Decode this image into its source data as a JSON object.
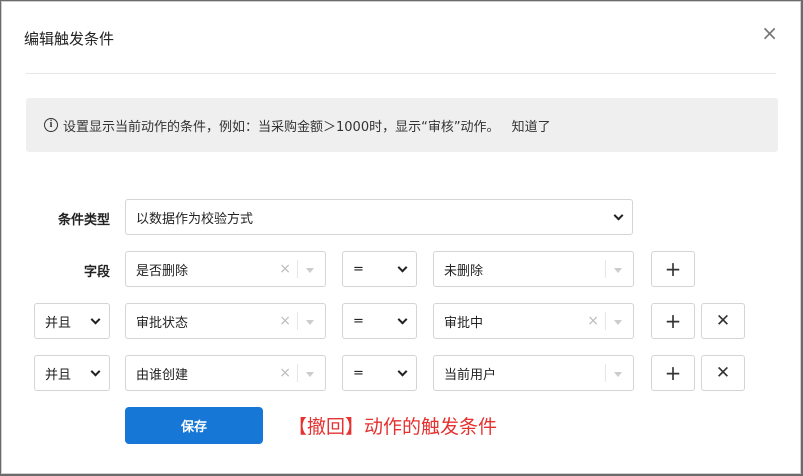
{
  "dialog": {
    "title": "编辑触发条件",
    "close_glyph": "×"
  },
  "notice": {
    "text": "设置显示当前动作的条件，例如：当采购金额＞1000时，显示“审核”动作。",
    "link": "知道了"
  },
  "form": {
    "condition_type_label": "条件类型",
    "condition_type_value": "以数据作为校验方式",
    "field_label": "字段",
    "rows": [
      {
        "logic": "",
        "field": "是否删除",
        "operator": "=",
        "value": "未删除",
        "removable": false
      },
      {
        "logic": "并且",
        "field": "审批状态",
        "operator": "=",
        "value": "审批中",
        "removable": true
      },
      {
        "logic": "并且",
        "field": "由谁创建",
        "operator": "=",
        "value": "当前用户",
        "removable": true
      }
    ],
    "add_glyph": "+",
    "remove_glyph": "✕",
    "clear_glyph": "×"
  },
  "save_label": "保存",
  "annotation": "【撤回】动作的触发条件"
}
